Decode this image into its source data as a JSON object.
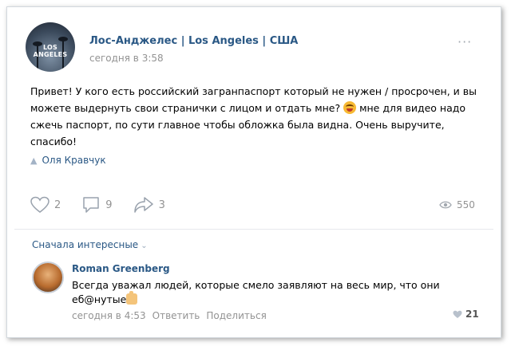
{
  "post": {
    "group_name": "Лос-Анджелес | Los Angeles | США",
    "avatar_logo_text": "LOS ANGELES",
    "time": "сегодня в 3:58",
    "more_label": "···",
    "text_part1": "Привет! У кого есть российский загранпаспорт который не нужен / просрочен, и вы можете выдернуть свои странички с лицом и отдать мне? ",
    "text_part2": " мне для видео надо сжечь паспорт, по сути главное чтобы обложка была видна. Очень выручите, спасибо!",
    "author": "Оля Кравчук",
    "likes": "2",
    "comments": "9",
    "shares": "3",
    "views": "550"
  },
  "comments_section": {
    "sort_label": "Сначала интересные",
    "comment": {
      "author": "Roman Greenberg",
      "text": "Всегда уважал людей, которые смело заявляют на весь мир, что они еб@нутые",
      "time": "сегодня в 4:53",
      "reply_label": "Ответить",
      "share_label": "Поделиться",
      "likes": "21"
    }
  },
  "icons": [
    "heart-icon",
    "comment-icon",
    "share-icon",
    "eye-icon",
    "person-icon",
    "chevron-down-icon",
    "emoji-icon",
    "thumbs-up-icon"
  ],
  "colors": {
    "link": "#2a5885",
    "muted": "#939393",
    "divider": "#e7e8ec"
  }
}
